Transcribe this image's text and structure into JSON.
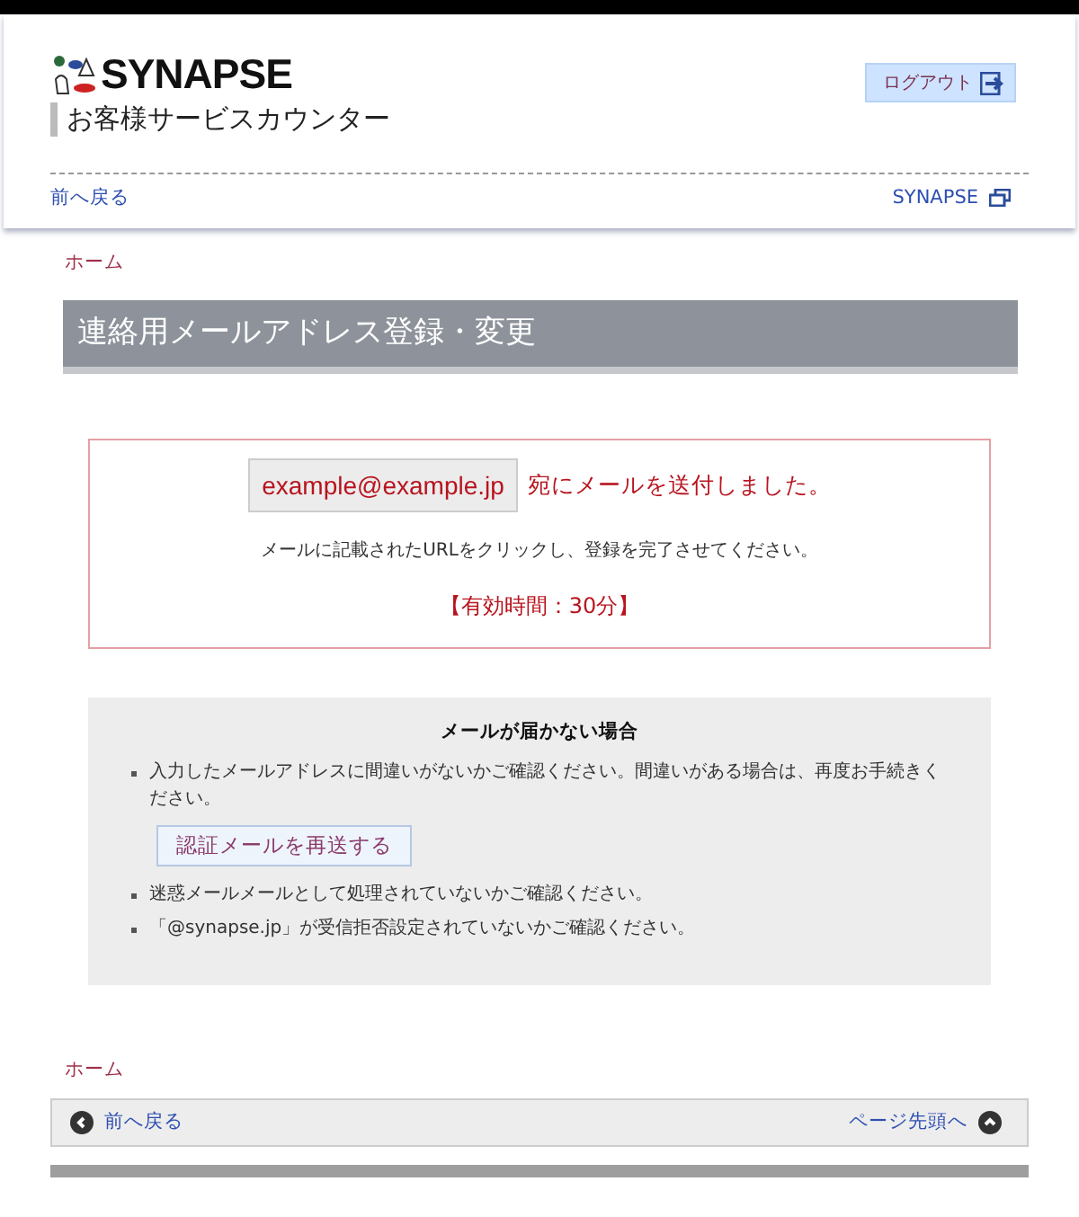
{
  "header": {
    "logo_text": "SYNAPSE",
    "subtitle": "お客様サービスカウンター",
    "logout": "ログアウト",
    "back": "前へ戻る",
    "site_link": "SYNAPSE"
  },
  "breadcrumb": "ホーム",
  "page_title": "連絡用メールアドレス登録・変更",
  "notice": {
    "email": "example@example.jp",
    "sent": "宛にメールを送付しました。",
    "instruction": "メールに記載されたURLをクリックし、登録を完了させてください。",
    "validity": "【有効時間：30分】"
  },
  "help": {
    "title": "メールが届かない場合",
    "items": [
      {
        "kind": "text",
        "text": "入力したメールアドレスに間違いがないかご確認ください。間違いがある場合は、再度お手続きください。"
      },
      {
        "kind": "button",
        "text": "認証メールを再送する"
      },
      {
        "kind": "text",
        "text": "迷惑メールメールとして処理されていないかご確認ください。"
      },
      {
        "kind": "text",
        "text": "「@synapse.jp」が受信拒否設定されていないかご確認ください。"
      }
    ]
  },
  "footer": {
    "breadcrumb": "ホーム",
    "back": "前へ戻る",
    "top": "ページ先頭へ"
  }
}
